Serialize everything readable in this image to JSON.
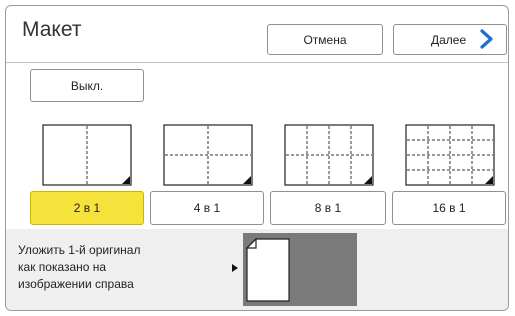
{
  "header": {
    "title": "Макет",
    "cancel_label": "Отмена",
    "next_label": "Далее"
  },
  "off_button": {
    "label": "Выкл."
  },
  "layout_options": [
    {
      "label": "2 в 1",
      "selected": true
    },
    {
      "label": "4 в 1",
      "selected": false
    },
    {
      "label": "8 в 1",
      "selected": false
    },
    {
      "label": "16 в 1",
      "selected": false
    }
  ],
  "instruction": {
    "line1": "Уложить 1-й оригинал",
    "line2": "как показано на",
    "line3": "изображении справа"
  },
  "colors": {
    "selected": "#f5e23a",
    "accent": "#1f6fd1"
  }
}
